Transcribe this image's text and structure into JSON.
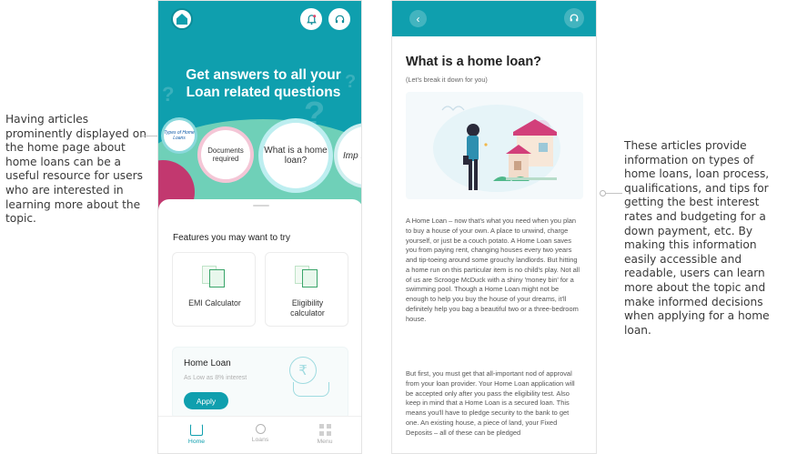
{
  "annotations": {
    "left": "Having articles prominently displayed on the home page about home loans can be a useful resource for users who are interested in learning more about the topic.",
    "right": "These articles provide information on types of home loans, loan process, qualifications, and tips for getting the best interest rates and budgeting for a down payment, etc. By making this information easily accessible and readable, users can learn more about the topic and make informed decisions when applying for a home loan."
  },
  "home_screen": {
    "hero_title": "Get answers to all your Loan related questions",
    "topics": [
      "Types of Home Loans",
      "Documents required",
      "What is a home loan?",
      "Imp Hor T"
    ],
    "features_title": "Features you may want to try",
    "features": [
      {
        "label": "EMI Calculator"
      },
      {
        "label": "Eligibility calculator"
      }
    ],
    "loan_card": {
      "title": "Home Loan",
      "subtitle": "As Low as 8% interest",
      "button": "Apply"
    },
    "nav": [
      "Home",
      "Loans",
      "Menu"
    ]
  },
  "article_screen": {
    "title": "What is a home loan?",
    "subtitle": "(Let's break it down for you)",
    "paragraphs": [
      "A Home Loan – now that's what you need when you plan to buy a house of your own. A place to unwind, charge yourself, or just be a couch potato. A Home Loan saves you from paying rent, changing houses every two years and tip-toeing around some grouchy landlords. But hitting a home run on this particular item is no child's play. Not all of us are Scrooge McDuck with a shiny 'money bin' for a swimming pool. Though a Home Loan might not be enough to help you buy the house of your dreams, it'll definitely help you bag a beautiful two or a three-bedroom house.",
      "But first, you must get that all-important nod of approval from your loan provider. Your Home Loan application will be accepted only after you pass the eligibility test.  Also keep in mind that a Home Loan is a secured loan. This means you'll have to pledge security to the bank to get one. An existing house, a piece of land, your Fixed Deposits – all of these can be pledged"
    ]
  },
  "colors": {
    "teal": "#0f9fae",
    "mint": "#6fd0b8",
    "pink": "#c2386f"
  }
}
